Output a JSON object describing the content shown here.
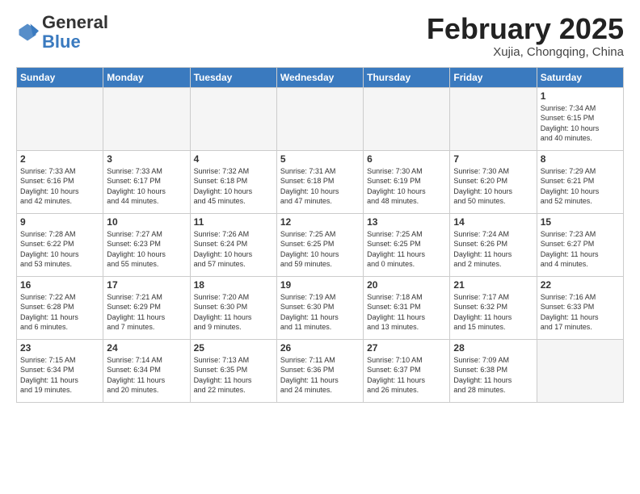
{
  "header": {
    "logo_general": "General",
    "logo_blue": "Blue",
    "month_title": "February 2025",
    "subtitle": "Xujia, Chongqing, China"
  },
  "weekdays": [
    "Sunday",
    "Monday",
    "Tuesday",
    "Wednesday",
    "Thursday",
    "Friday",
    "Saturday"
  ],
  "weeks": [
    [
      {
        "day": "",
        "info": ""
      },
      {
        "day": "",
        "info": ""
      },
      {
        "day": "",
        "info": ""
      },
      {
        "day": "",
        "info": ""
      },
      {
        "day": "",
        "info": ""
      },
      {
        "day": "",
        "info": ""
      },
      {
        "day": "1",
        "info": "Sunrise: 7:34 AM\nSunset: 6:15 PM\nDaylight: 10 hours\nand 40 minutes."
      }
    ],
    [
      {
        "day": "2",
        "info": "Sunrise: 7:33 AM\nSunset: 6:16 PM\nDaylight: 10 hours\nand 42 minutes."
      },
      {
        "day": "3",
        "info": "Sunrise: 7:33 AM\nSunset: 6:17 PM\nDaylight: 10 hours\nand 44 minutes."
      },
      {
        "day": "4",
        "info": "Sunrise: 7:32 AM\nSunset: 6:18 PM\nDaylight: 10 hours\nand 45 minutes."
      },
      {
        "day": "5",
        "info": "Sunrise: 7:31 AM\nSunset: 6:18 PM\nDaylight: 10 hours\nand 47 minutes."
      },
      {
        "day": "6",
        "info": "Sunrise: 7:30 AM\nSunset: 6:19 PM\nDaylight: 10 hours\nand 48 minutes."
      },
      {
        "day": "7",
        "info": "Sunrise: 7:30 AM\nSunset: 6:20 PM\nDaylight: 10 hours\nand 50 minutes."
      },
      {
        "day": "8",
        "info": "Sunrise: 7:29 AM\nSunset: 6:21 PM\nDaylight: 10 hours\nand 52 minutes."
      }
    ],
    [
      {
        "day": "9",
        "info": "Sunrise: 7:28 AM\nSunset: 6:22 PM\nDaylight: 10 hours\nand 53 minutes."
      },
      {
        "day": "10",
        "info": "Sunrise: 7:27 AM\nSunset: 6:23 PM\nDaylight: 10 hours\nand 55 minutes."
      },
      {
        "day": "11",
        "info": "Sunrise: 7:26 AM\nSunset: 6:24 PM\nDaylight: 10 hours\nand 57 minutes."
      },
      {
        "day": "12",
        "info": "Sunrise: 7:25 AM\nSunset: 6:25 PM\nDaylight: 10 hours\nand 59 minutes."
      },
      {
        "day": "13",
        "info": "Sunrise: 7:25 AM\nSunset: 6:25 PM\nDaylight: 11 hours\nand 0 minutes."
      },
      {
        "day": "14",
        "info": "Sunrise: 7:24 AM\nSunset: 6:26 PM\nDaylight: 11 hours\nand 2 minutes."
      },
      {
        "day": "15",
        "info": "Sunrise: 7:23 AM\nSunset: 6:27 PM\nDaylight: 11 hours\nand 4 minutes."
      }
    ],
    [
      {
        "day": "16",
        "info": "Sunrise: 7:22 AM\nSunset: 6:28 PM\nDaylight: 11 hours\nand 6 minutes."
      },
      {
        "day": "17",
        "info": "Sunrise: 7:21 AM\nSunset: 6:29 PM\nDaylight: 11 hours\nand 7 minutes."
      },
      {
        "day": "18",
        "info": "Sunrise: 7:20 AM\nSunset: 6:30 PM\nDaylight: 11 hours\nand 9 minutes."
      },
      {
        "day": "19",
        "info": "Sunrise: 7:19 AM\nSunset: 6:30 PM\nDaylight: 11 hours\nand 11 minutes."
      },
      {
        "day": "20",
        "info": "Sunrise: 7:18 AM\nSunset: 6:31 PM\nDaylight: 11 hours\nand 13 minutes."
      },
      {
        "day": "21",
        "info": "Sunrise: 7:17 AM\nSunset: 6:32 PM\nDaylight: 11 hours\nand 15 minutes."
      },
      {
        "day": "22",
        "info": "Sunrise: 7:16 AM\nSunset: 6:33 PM\nDaylight: 11 hours\nand 17 minutes."
      }
    ],
    [
      {
        "day": "23",
        "info": "Sunrise: 7:15 AM\nSunset: 6:34 PM\nDaylight: 11 hours\nand 19 minutes."
      },
      {
        "day": "24",
        "info": "Sunrise: 7:14 AM\nSunset: 6:34 PM\nDaylight: 11 hours\nand 20 minutes."
      },
      {
        "day": "25",
        "info": "Sunrise: 7:13 AM\nSunset: 6:35 PM\nDaylight: 11 hours\nand 22 minutes."
      },
      {
        "day": "26",
        "info": "Sunrise: 7:11 AM\nSunset: 6:36 PM\nDaylight: 11 hours\nand 24 minutes."
      },
      {
        "day": "27",
        "info": "Sunrise: 7:10 AM\nSunset: 6:37 PM\nDaylight: 11 hours\nand 26 minutes."
      },
      {
        "day": "28",
        "info": "Sunrise: 7:09 AM\nSunset: 6:38 PM\nDaylight: 11 hours\nand 28 minutes."
      },
      {
        "day": "",
        "info": ""
      }
    ]
  ]
}
